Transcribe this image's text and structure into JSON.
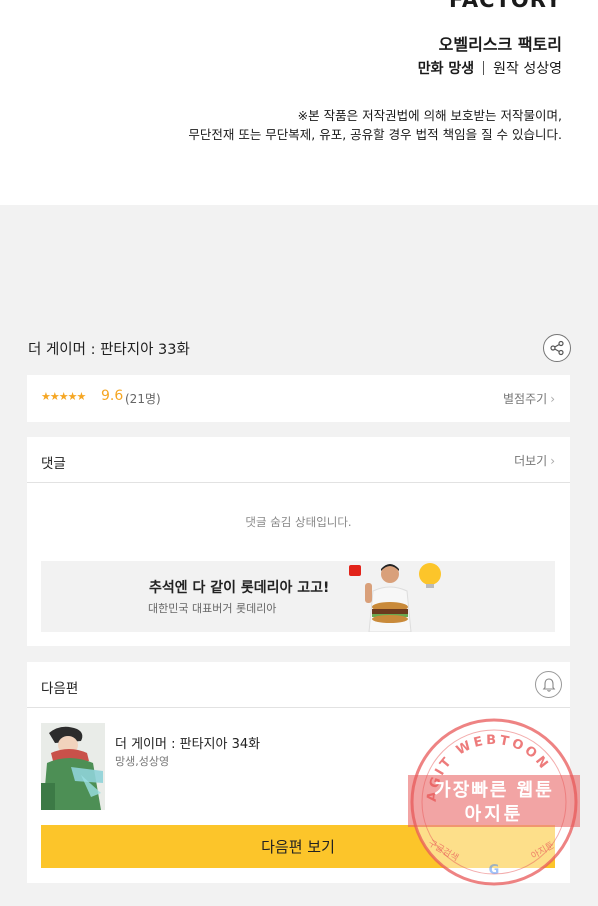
{
  "publisher": {
    "logo_text": "FACTORY",
    "name": "오벨리스크 팩토리",
    "comic_label": "만화 망생",
    "original_label": "원작 성상영"
  },
  "copyright": {
    "line1": "※본 작품은 저작권법에 의해 보호받는 저작물이며,",
    "line2": "무단전재 또는 무단복제, 유포, 공유할 경우 법적 책임을 질 수 있습니다."
  },
  "episode": {
    "title": "더 게이머 : 판타지아 33화",
    "share_icon": "share-icon"
  },
  "rating": {
    "stars": "★★★★★",
    "score": "9.6",
    "count": "(21명)",
    "rate_label": "별점주기",
    "star_color": "#f5a623"
  },
  "comments": {
    "label": "댓글",
    "more_label": "더보기",
    "hidden_message": "댓글 숨김 상태입니다."
  },
  "ad": {
    "title": "추석엔 다 같이 롯데리아 고고!",
    "subtitle": "대한민국 대표버거 롯데리아"
  },
  "next_episode": {
    "label": "다음편",
    "bell_icon": "bell-icon",
    "title": "더 게이머 : 판타지아 34화",
    "authors": "망생,성상영",
    "button_label": "다음편 보기",
    "button_color": "#fcc52a"
  },
  "watermark": {
    "arc_text": "AGIT WEBTOON",
    "line1": "가장빠른 웹툰",
    "line2": "아지툰",
    "bottom_left": "구글검색",
    "bottom_right": "아지툰"
  }
}
